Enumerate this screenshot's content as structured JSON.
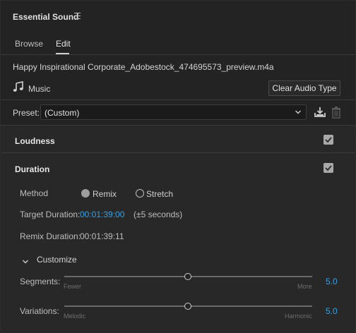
{
  "header": {
    "title": "Essential Sound"
  },
  "tabs": [
    {
      "label": "Browse"
    },
    {
      "label": "Edit"
    }
  ],
  "clip": {
    "filename": "Happy Inspirational Corporate_Adobestock_474695573_preview.m4a"
  },
  "audio_type": {
    "label": "Music",
    "clear_button": "Clear Audio Type"
  },
  "preset": {
    "label": "Preset:",
    "value": "(Custom)"
  },
  "sections": {
    "loudness": {
      "title": "Loudness",
      "checked": true
    },
    "duration": {
      "title": "Duration",
      "checked": true
    }
  },
  "duration": {
    "method_label": "Method",
    "method_options": [
      {
        "label": "Remix",
        "selected": true
      },
      {
        "label": "Stretch",
        "selected": false
      }
    ],
    "target_label": "Target Duration:",
    "target_value": "00:01:39:00",
    "target_tolerance": "(±5 seconds)",
    "remix_label": "Remix Duration:",
    "remix_value": "00:01:39:11"
  },
  "customize": {
    "label": "Customize",
    "sliders": [
      {
        "label": "Segments:",
        "min_label": "Fewer",
        "max_label": "More",
        "value": "5.0",
        "position": 0.5
      },
      {
        "label": "Variations:",
        "min_label": "Melodic",
        "max_label": "Harmonic",
        "value": "5.0",
        "position": 0.5
      }
    ]
  },
  "colors": {
    "accent": "#3d9fe0",
    "panel": "#232323",
    "section": "#282828"
  },
  "icons": [
    "menu-icon",
    "music-note-icon",
    "chevron-down-icon",
    "save-preset-icon",
    "trash-icon",
    "checkbox-icon"
  ]
}
